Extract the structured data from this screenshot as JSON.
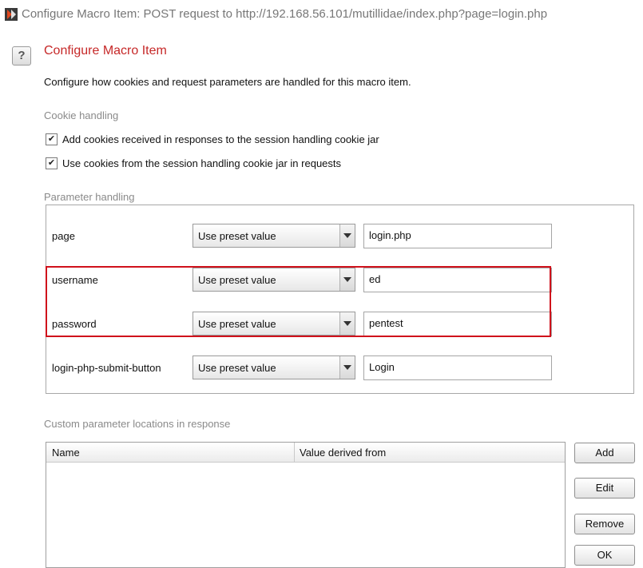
{
  "window": {
    "title": "Configure Macro Item: POST request to http://192.168.56.101/mutillidae/index.php?page=login.php",
    "app_icon": "burp-suite-icon"
  },
  "dialog": {
    "help_icon": "?",
    "title": "Configure Macro Item",
    "description": "Configure how cookies and request parameters are handled for this macro item."
  },
  "cookie_handling": {
    "label": "Cookie handling",
    "options": [
      {
        "label": "Add cookies received in responses to the session handling cookie jar",
        "checked": true,
        "mark": "✔"
      },
      {
        "label": "Use cookies from the session handling cookie jar in requests",
        "checked": true,
        "mark": "✔"
      }
    ]
  },
  "parameter_handling": {
    "label": "Parameter handling",
    "params": [
      {
        "name": "page",
        "mode": "Use preset value",
        "value": "login.php"
      },
      {
        "name": "username",
        "mode": "Use preset value",
        "value": "ed"
      },
      {
        "name": "password",
        "mode": "Use preset value",
        "value": "pentest"
      },
      {
        "name": "login-php-submit-button",
        "mode": "Use preset value",
        "value": "Login"
      }
    ],
    "highlight_color": "#d0111b"
  },
  "custom_locations": {
    "label": "Custom parameter locations in response",
    "columns": [
      "Name",
      "Value derived from"
    ]
  },
  "buttons": {
    "add": "Add",
    "edit": "Edit",
    "remove": "Remove",
    "ok": "OK"
  },
  "colors": {
    "title_accent": "#c62828"
  }
}
